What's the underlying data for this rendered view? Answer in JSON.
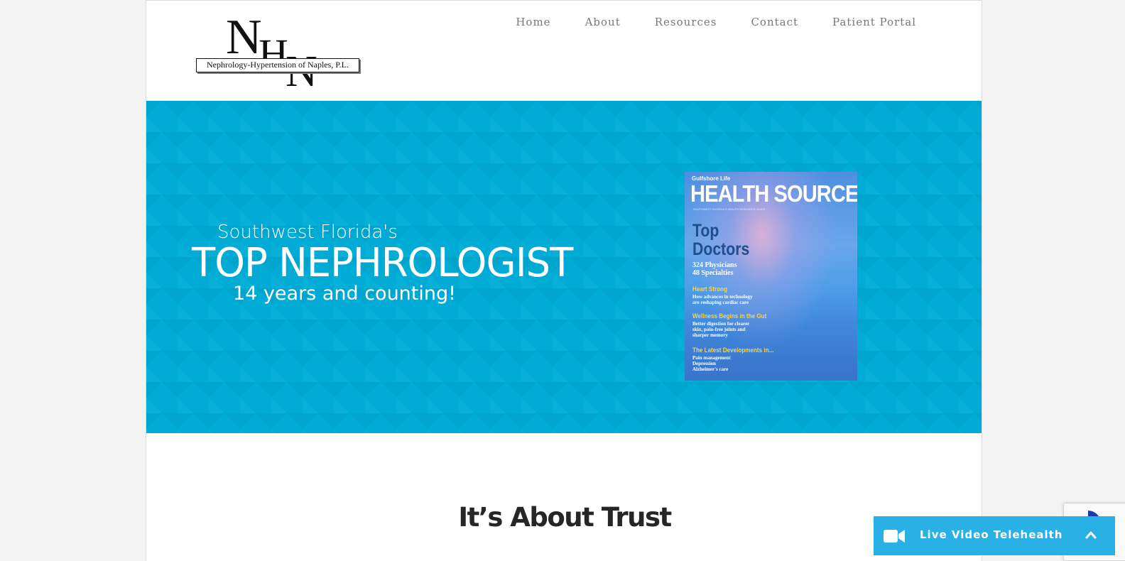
{
  "header": {
    "logo": {
      "letters": "NHN",
      "caption": "Nephrology-Hypertension of Naples, P.L."
    },
    "nav": [
      {
        "label": "Home"
      },
      {
        "label": "About"
      },
      {
        "label": "Resources"
      },
      {
        "label": "Contact"
      },
      {
        "label": "Patient Portal"
      }
    ]
  },
  "hero": {
    "pretitle": "Southwest Florida's",
    "title": "TOP NEPHROLOGIST",
    "subtitle": "14 years and counting!",
    "background_color": "#00acd6",
    "cover": {
      "brand": "Gulfshore Life",
      "masthead": "HEALTH SOURCE",
      "tagline": "SOUTHWEST FLORIDA'S HEALTH RESOURCE GUIDE",
      "feature": [
        "Top",
        "Doctors"
      ],
      "stats": [
        "324 Physicians",
        "48 Specialties"
      ],
      "stories": [
        {
          "headline": "Heart Strong",
          "lines": [
            "How advances in technology",
            "are reshaping cardiac care"
          ]
        },
        {
          "headline": "Wellness Begins in the Gut",
          "lines": [
            "Better digestion for clearer",
            "skin, pain-free joints and",
            "sharper memory"
          ]
        },
        {
          "headline": "The Latest Developments in...",
          "lines": [
            "Pain management",
            "Depression",
            "Alzheimer's care"
          ]
        }
      ]
    }
  },
  "section": {
    "heading": "It’s About Trust"
  },
  "telehealth": {
    "label": "Live Video Telehealth",
    "icon": "video-camera-icon",
    "toggle_icon": "chevron-up-icon",
    "color": "#29b1e5"
  },
  "recaptcha": {
    "icon": "recaptcha-icon"
  }
}
